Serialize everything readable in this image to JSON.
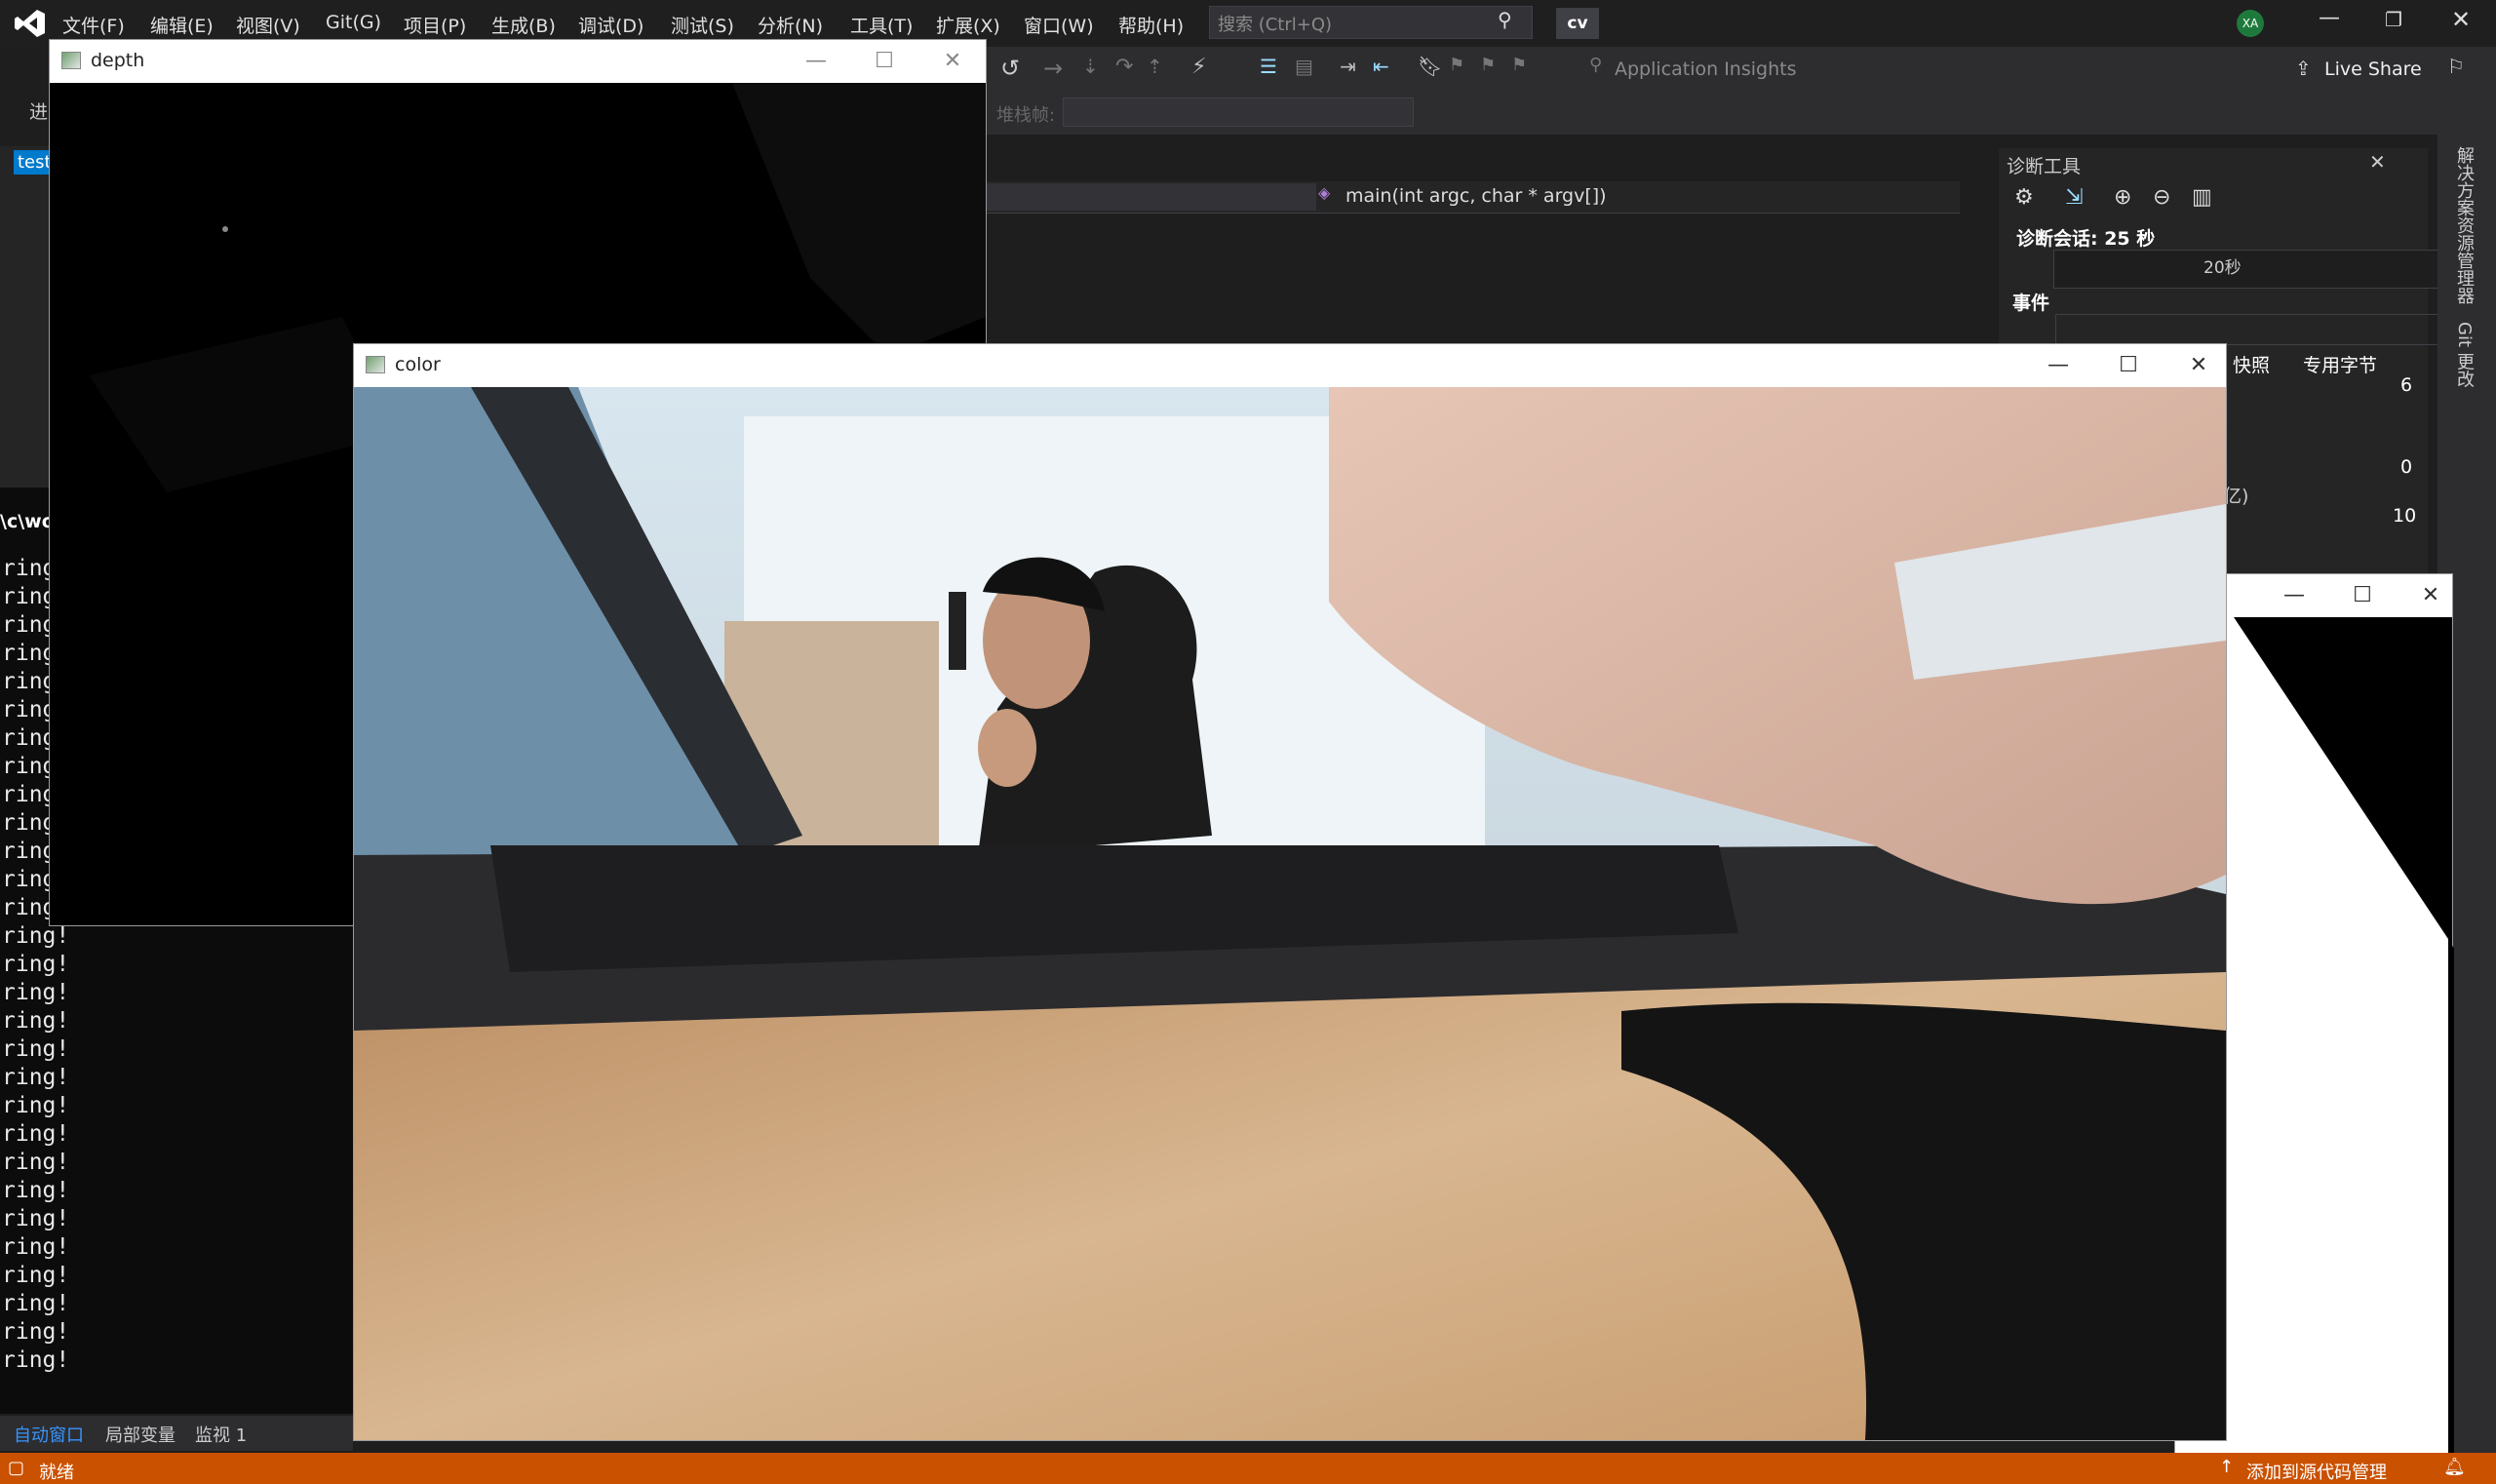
{
  "menu": [
    "文件(F)",
    "编辑(E)",
    "视图(V)",
    "Git(G)",
    "项目(P)",
    "生成(B)",
    "调试(D)",
    "测试(S)",
    "分析(N)",
    "工具(T)",
    "扩展(X)",
    "窗口(W)",
    "帮助(H)"
  ],
  "search": {
    "placeholder": "搜索 (Ctrl+Q)"
  },
  "solution_name": "cv",
  "user_initials": "XA",
  "toolbar": {
    "app_insights": "Application Insights",
    "live_share": "Live Share",
    "stack_frame": "堆栈帧:"
  },
  "nav": {
    "function": "main(int argc, char * argv[])"
  },
  "diag": {
    "title": "诊断工具",
    "session": "诊断会话: 25 秒",
    "timeline_label": "20秒",
    "events": "事件",
    "legend_snapshot": "快照",
    "legend_bytes": "专用字节",
    "y_top": "6",
    "y_bottom": "0",
    "y2_top": "10",
    "partial": "亿)"
  },
  "right_tabs": [
    "解决方案资源管理器",
    "Git 更改"
  ],
  "left_panel": {
    "test_tab": "test",
    "path": "\\c\\wor",
    "jin": "进"
  },
  "console_lines": [
    "ring",
    "ring",
    "ring",
    "ring",
    "ring",
    "ring",
    "ring",
    "ring",
    "ring",
    "ring",
    "ring",
    "ring",
    "ring!",
    "ring!",
    "ring!",
    "ring!",
    "ring!",
    "ring!",
    "ring!",
    "ring!",
    "ring!",
    "ring!",
    "ring!",
    "ring!",
    "ring!",
    "ring!",
    "ring!",
    "ring!",
    "ring!"
  ],
  "bottom_tabs": [
    "自动窗口",
    "局部变量",
    "监视 1"
  ],
  "status": {
    "ready": "就绪",
    "source_control": "添加到源代码管理"
  },
  "windows": {
    "depth": {
      "title": "depth"
    },
    "color": {
      "title": "color"
    }
  }
}
